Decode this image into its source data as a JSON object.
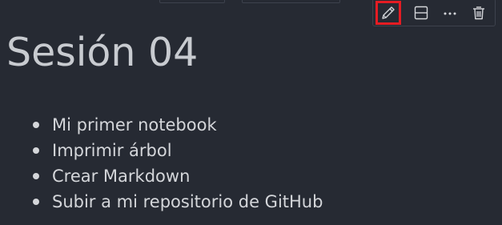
{
  "toolbar": {
    "actions": [
      {
        "name": "edit",
        "icon": "pencil-icon",
        "highlighted": true,
        "highlight_color": "#e51c23"
      },
      {
        "name": "split",
        "icon": "split-cell-icon"
      },
      {
        "name": "more",
        "icon": "more-actions-icon"
      },
      {
        "name": "delete",
        "icon": "trash-icon"
      }
    ]
  },
  "cell": {
    "title": "Sesión 04",
    "items": [
      "Mi primer notebook",
      "Imprimir árbol",
      "Crear Markdown",
      "Subir a mi repositorio de GitHub"
    ]
  },
  "colors": {
    "background": "#262a33",
    "text": "#d4d6da",
    "highlight": "#e51c23"
  }
}
